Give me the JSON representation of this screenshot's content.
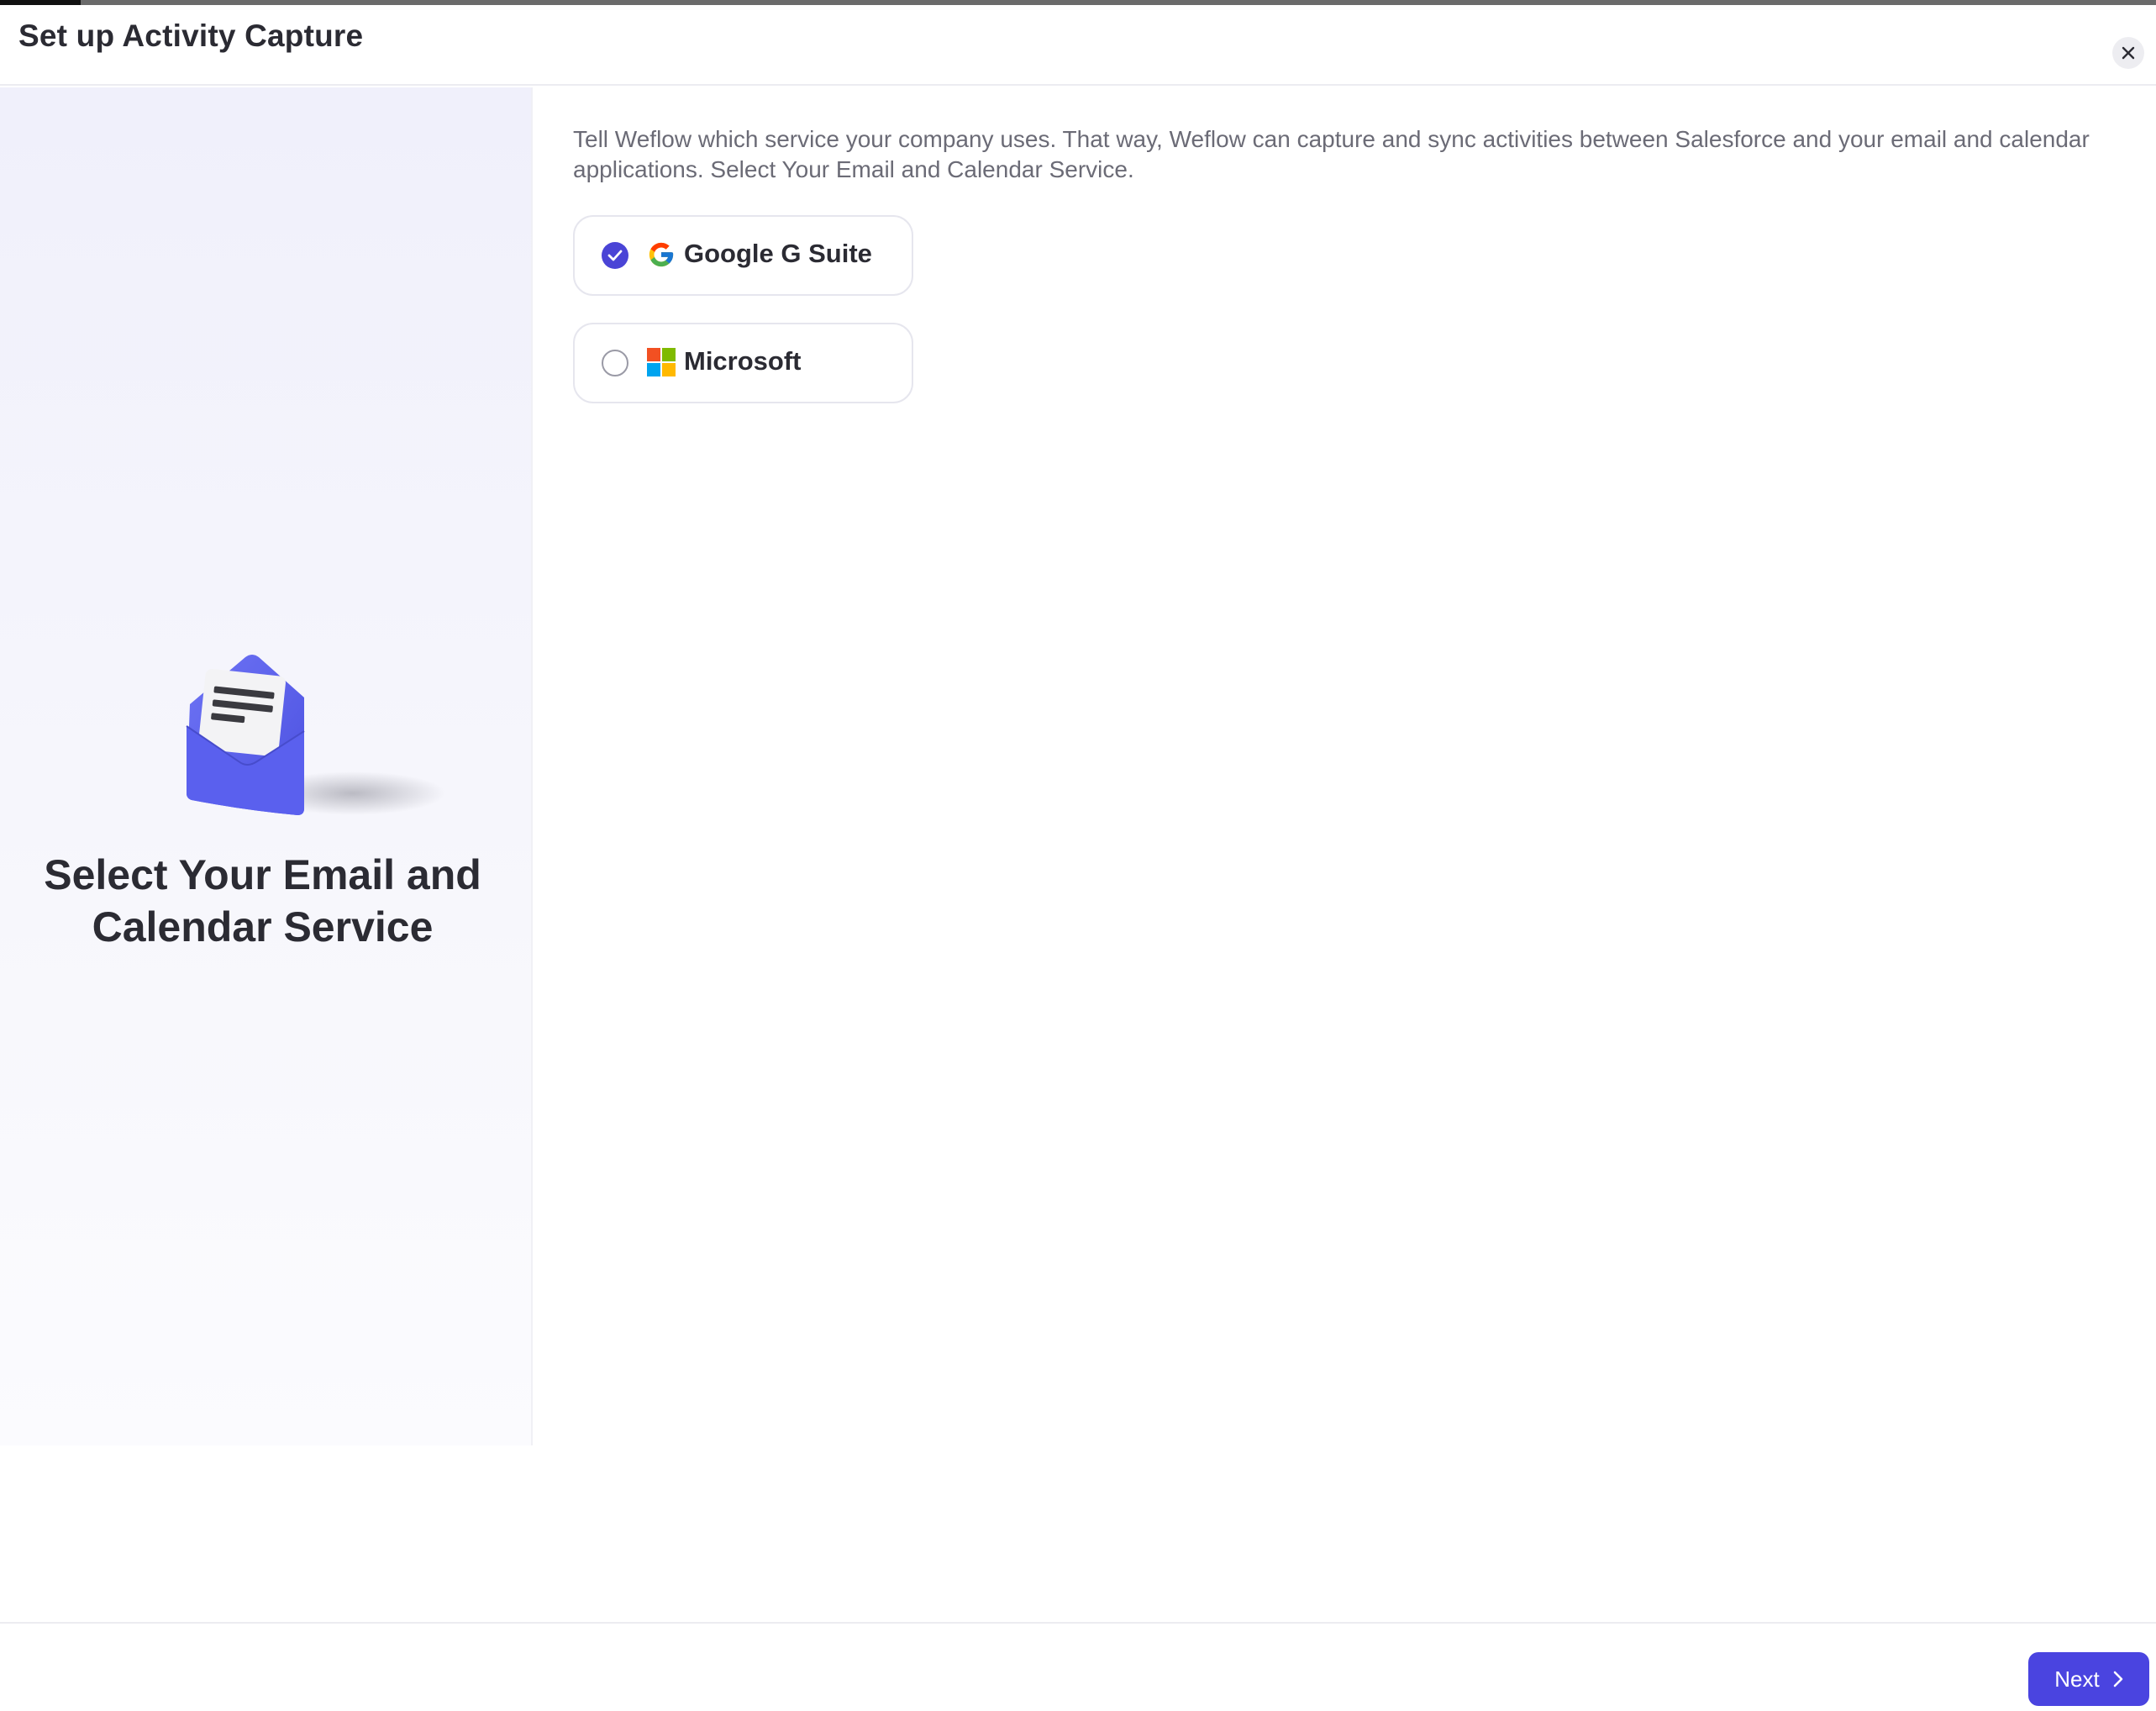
{
  "header": {
    "title": "Set up Activity Capture",
    "close_icon": "close-icon"
  },
  "left_panel": {
    "illustration_icon": "envelope-letter-icon",
    "heading": "Select Your Email and Calendar Service"
  },
  "main": {
    "description": "Tell Weflow which service your company uses. That way, Weflow can capture and sync activities between Salesforce and your email and calendar applications. Select Your Email and Calendar Service.",
    "options": [
      {
        "label": "Google G Suite",
        "icon": "google-g-icon",
        "selected": true
      },
      {
        "label": "Microsoft",
        "icon": "microsoft-logo-icon",
        "selected": false
      }
    ]
  },
  "footer": {
    "next_label": "Next",
    "next_icon": "chevron-right-icon"
  },
  "colors": {
    "accent": "#4a44e0",
    "text_primary": "#2b2b33",
    "text_secondary": "#6b6b76"
  }
}
